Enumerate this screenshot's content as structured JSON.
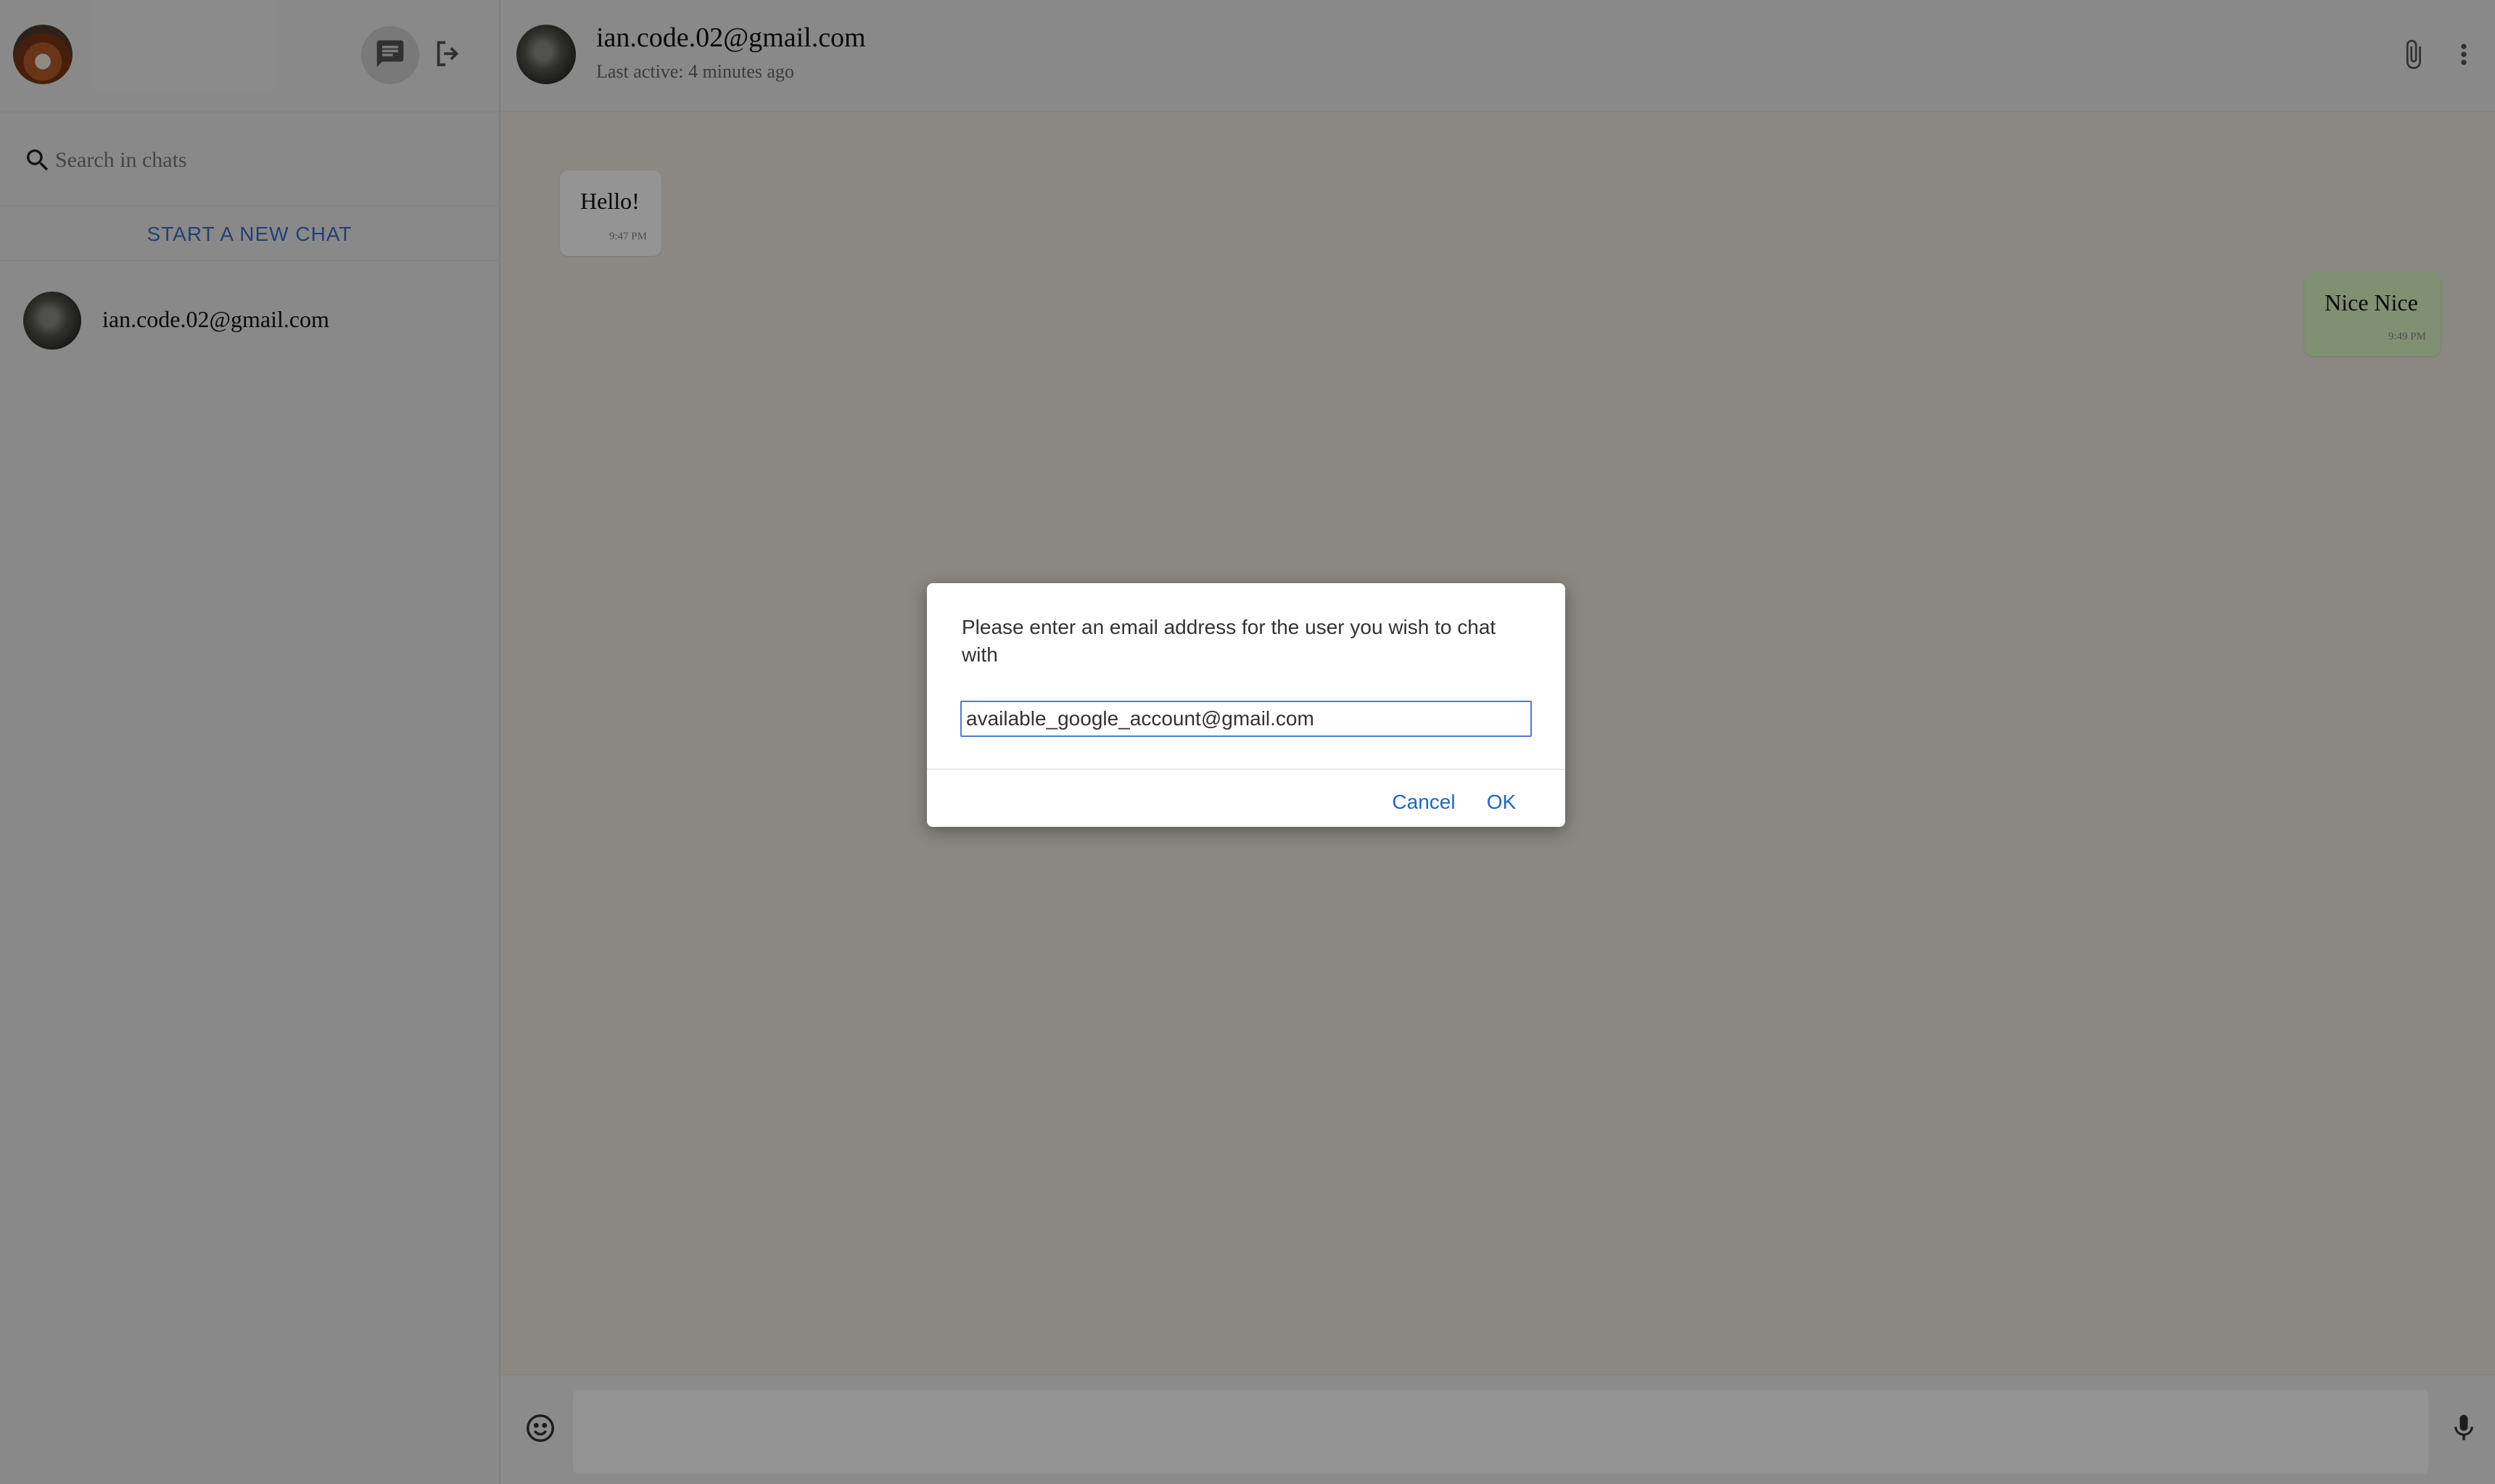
{
  "sidebar": {
    "search_placeholder": "Search in chats",
    "new_chat_label": "START A NEW CHAT",
    "chats": [
      {
        "name": "ian.code.02@gmail.com"
      }
    ]
  },
  "header": {
    "contact_name": "ian.code.02@gmail.com",
    "status": "Last active: 4 minutes ago"
  },
  "messages": [
    {
      "direction": "incoming",
      "text": "Hello!",
      "time": "9:47 PM"
    },
    {
      "direction": "outgoing",
      "text": "Nice Nice",
      "time": "9:49 PM"
    }
  ],
  "dialog": {
    "message": "Please enter an email address for the user you wish to chat with",
    "input_value": "available_google_account@gmail.com",
    "cancel_label": "Cancel",
    "ok_label": "OK"
  },
  "icons": {
    "chat": "chat-icon",
    "logout": "logout-icon",
    "search": "search-icon",
    "attach": "paperclip-icon",
    "more": "more-vert-icon",
    "emoji": "emoji-icon",
    "mic": "mic-icon"
  },
  "colors": {
    "accent": "#3f6fc8",
    "outgoing_bubble": "#dcf8c6",
    "dialog_button": "#1a66d2"
  }
}
